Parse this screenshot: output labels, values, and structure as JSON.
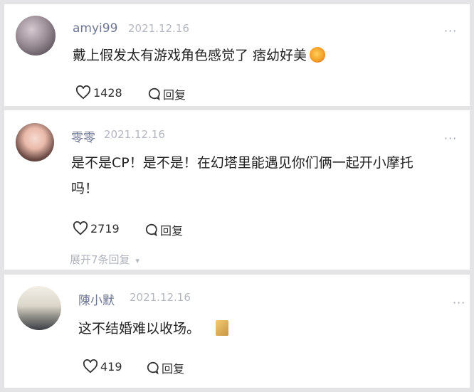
{
  "comments": [
    {
      "username": "amyi99",
      "date": "2021.12.16",
      "text": "戴上假发太有游戏角色感觉了 痞幼好美",
      "emoji": "heart-eyes-emoji",
      "likes": "1428",
      "reply_label": "回复"
    },
    {
      "username": "零零",
      "date": "2021.12.16",
      "text_line1": "是不是CP！是不是！在幻塔里能遇见你们俩一起开小摩托",
      "text_line2": "吗！",
      "likes": "2719",
      "reply_label": "回复",
      "expand_label": "展开7条回复"
    },
    {
      "username": "陳小默",
      "date": "2021.12.16",
      "text": "这不结婚难以收场。",
      "emoji": "sticker-emoji",
      "likes": "419",
      "reply_label": "回复"
    }
  ],
  "more_glyph": "···",
  "expand_arrow": "▾"
}
